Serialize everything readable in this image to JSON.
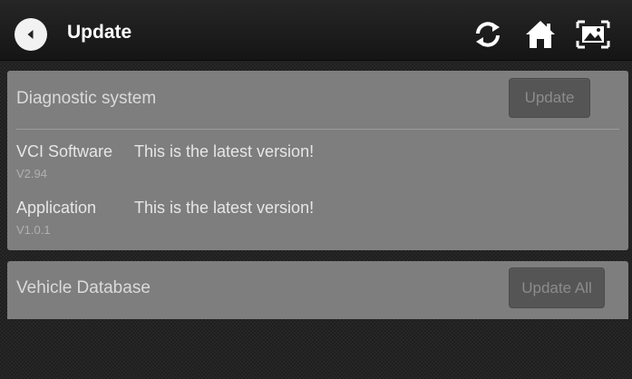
{
  "header": {
    "title": "Update",
    "icons": [
      "back-arrow-icon",
      "refresh-icon",
      "home-icon",
      "screenshot-icon"
    ]
  },
  "diagnostic": {
    "title": "Diagnostic system",
    "update_label": "Update",
    "items": [
      {
        "name": "VCI Software",
        "status": "This is the latest version!",
        "version": "V2.94"
      },
      {
        "name": "Application",
        "status": "This is the latest version!",
        "version": "V1.0.1"
      }
    ]
  },
  "vehicle": {
    "title": "Vehicle Database",
    "update_all_label": "Update All"
  },
  "colors": {
    "panel": "#7e7e7e",
    "button": "#555555",
    "topbar": "#1a1a1a"
  }
}
